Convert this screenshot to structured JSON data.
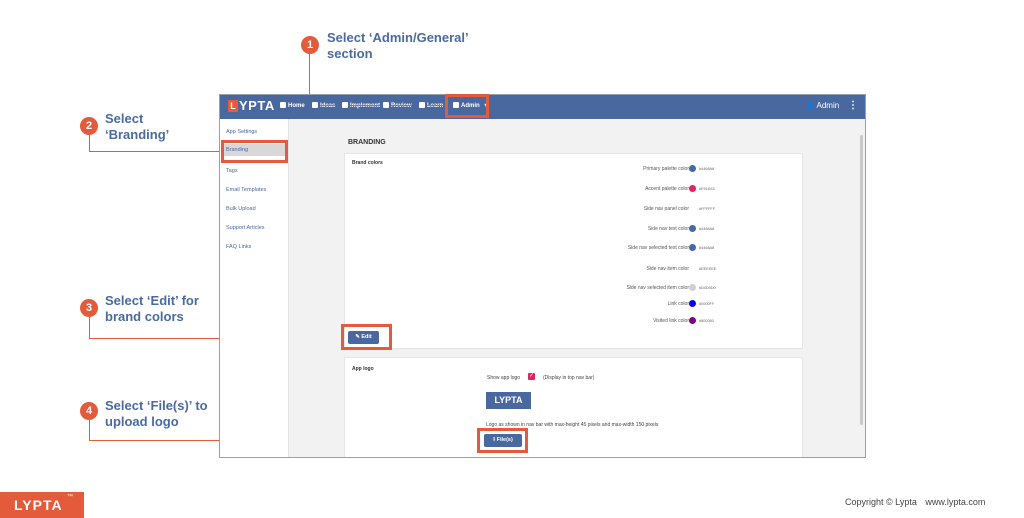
{
  "annotations": {
    "step1": {
      "num": "1",
      "line1": "Select ‘Admin/General’",
      "line2": "section"
    },
    "step2": {
      "num": "2",
      "line1": "Select",
      "line2": "‘Branding’"
    },
    "step3": {
      "num": "3",
      "line1": "Select ‘Edit’ for",
      "line2": "brand colors"
    },
    "step4": {
      "num": "4",
      "line1": "Select ‘File(s)’ to",
      "line2": "upload logo"
    }
  },
  "topbar": {
    "logo_mark": "L",
    "logo_text": "YPTA",
    "nav": [
      "Home",
      "Ideas",
      "Implement",
      "Review",
      "Learn",
      "Admin"
    ],
    "user_label": "Admin",
    "menu_glyph": "⋮"
  },
  "sidebar": {
    "items": [
      "App Settings",
      "Branding",
      "Tags",
      "Email Templates",
      "Bulk Upload",
      "Support Articles",
      "FAQ Links"
    ]
  },
  "main": {
    "title": "BRANDING",
    "brand_colors": {
      "heading": "Brand colors",
      "rows": [
        {
          "label": "Primary palette color",
          "color": "#4468a8",
          "hex": "#4468A8"
        },
        {
          "label": "Accent palette color",
          "color": "#e91e63",
          "hex": "#E91E63"
        },
        {
          "label": "Side nav panel color",
          "color": "",
          "hex": "#FFFFFF"
        },
        {
          "label": "Side nav text color",
          "color": "#4468a8",
          "hex": "#4468A8"
        },
        {
          "label": "Side nav selected text color",
          "color": "#4468a8",
          "hex": "#4468A8"
        },
        {
          "label": "Side nav item color",
          "color": "",
          "hex": "#EEEEEE"
        },
        {
          "label": "Side nav selected item color",
          "color": "#d0d0d0",
          "hex": "#D0D0D0"
        },
        {
          "label": "Link color",
          "color": "#0000ff",
          "hex": "#0000FF"
        },
        {
          "label": "Visited link color",
          "color": "#800080",
          "hex": "#800080"
        }
      ],
      "edit_label": "Edit"
    },
    "app_logo": {
      "heading": "App logo",
      "show_label": "Show app logo",
      "display_hint": "(Display in top nav bar)",
      "logo_text": "LYPTA",
      "caption": "Logo as shown in nav bar with max-height 45 pixels and max-width 150 pixels",
      "files_label": "File(s)"
    }
  },
  "footer": {
    "brand": "LYPTA",
    "tm": "™",
    "copyright": "Copyright © Lypta",
    "website": "www.lypta.com"
  }
}
